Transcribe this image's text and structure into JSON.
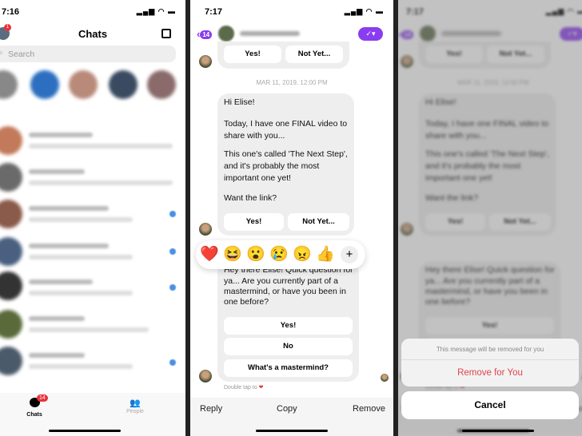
{
  "chats_screen": {
    "time": "7:16",
    "title": "Chats",
    "search_placeholder": "Search",
    "profile_badge": "1",
    "tabs": [
      {
        "label": "Chats",
        "badge": "14"
      },
      {
        "label": "People"
      }
    ]
  },
  "conversation": {
    "time": "7:17",
    "back_badge": "14",
    "date_divider": "MAR 11, 2019, 12:00 PM",
    "top_buttons": [
      "Yes!",
      "Not Yet..."
    ],
    "message1": [
      "Hi Elise!",
      "Today, I have one FINAL video to",
      "share with you...",
      "This one's called 'The Next Step',",
      "and it's probably the most",
      "important one yet!",
      "Want the link?"
    ],
    "message1_buttons": [
      "Yes!",
      "Not Yet..."
    ],
    "reactions": [
      "❤️",
      "😆",
      "😮",
      "😢",
      "😠",
      "👍"
    ],
    "more_reactions": "+",
    "message2": [
      "Hey there Elise! Quick question for",
      "ya... Are you currently part of a",
      "mastermind, or have you been in",
      "one before?"
    ],
    "message2_buttons": [
      "Yes!",
      "No",
      "What's a mastermind?"
    ],
    "double_tap": "Double tap to",
    "actions": [
      "Reply",
      "Copy",
      "Remove"
    ]
  },
  "remove_sheet": {
    "message": "This message will be removed for you",
    "remove_label": "Remove for You",
    "cancel_label": "Cancel",
    "accent": "#e0434b"
  },
  "colors": {
    "accent": "#8a3cf0",
    "badge": "#e8333c"
  }
}
